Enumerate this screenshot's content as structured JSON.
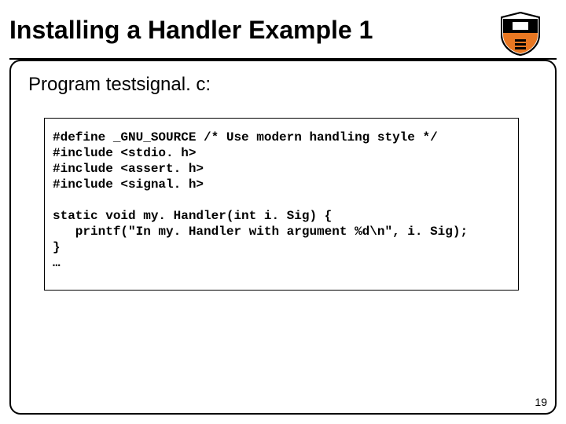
{
  "slide": {
    "title": "Installing a Handler Example 1",
    "subtitle": "Program testsignal. c:",
    "page_number": "19",
    "logo_alt": "princeton-shield"
  },
  "code": {
    "lines": [
      "#define _GNU_SOURCE /* Use modern handling style */",
      "#include <stdio. h>",
      "#include <assert. h>",
      "#include <signal. h>",
      "",
      "static void my. Handler(int i. Sig) {",
      "   printf(\"In my. Handler with argument %d\\n\", i. Sig);",
      "}",
      "…"
    ]
  }
}
